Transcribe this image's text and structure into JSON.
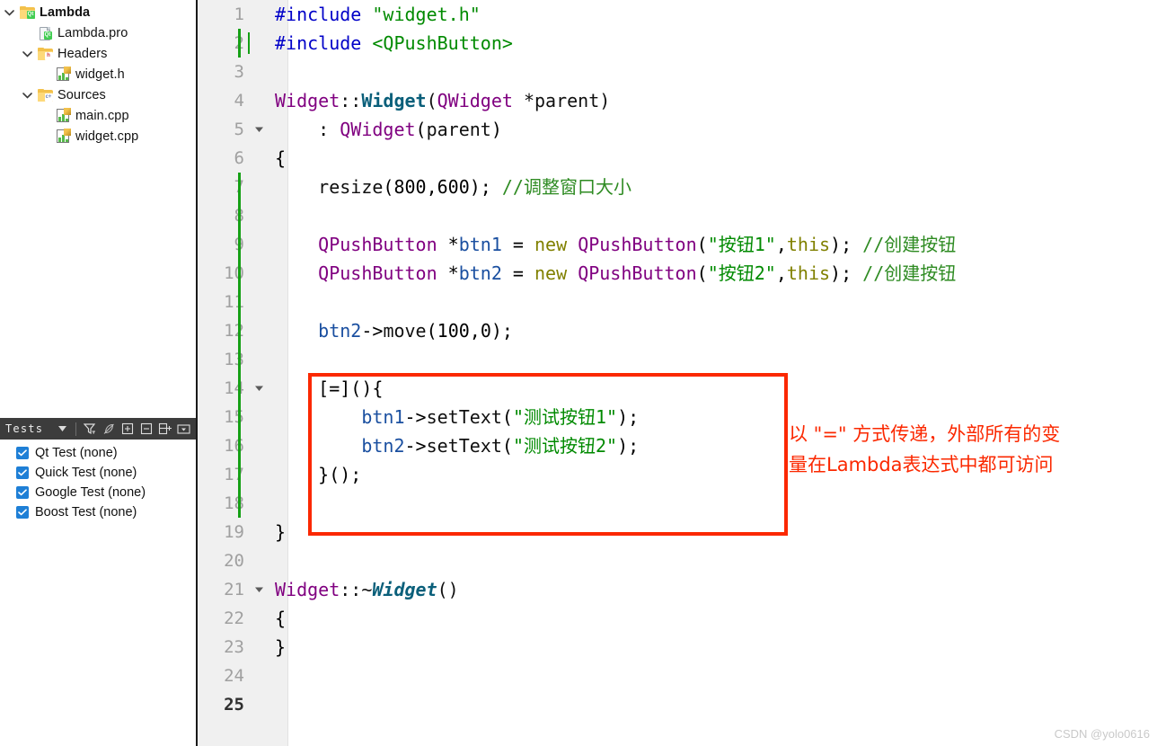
{
  "sidebar": {
    "tree": [
      {
        "label": "Lambda",
        "indent": 0,
        "chevron": "down",
        "icon": "folder-qt-icon",
        "bold": true
      },
      {
        "label": "Lambda.pro",
        "indent": 1,
        "chevron": "none",
        "icon": "file-qt-icon",
        "bold": false
      },
      {
        "label": "Headers",
        "indent": 1,
        "chevron": "down",
        "icon": "folder-h-icon",
        "bold": false
      },
      {
        "label": "widget.h",
        "indent": 2,
        "chevron": "none",
        "icon": "source-file-icon",
        "bold": false
      },
      {
        "label": "Sources",
        "indent": 1,
        "chevron": "down",
        "icon": "folder-cpp-icon",
        "bold": false
      },
      {
        "label": "main.cpp",
        "indent": 2,
        "chevron": "none",
        "icon": "source-file-icon",
        "bold": false
      },
      {
        "label": "widget.cpp",
        "indent": 2,
        "chevron": "none",
        "icon": "source-file-icon",
        "bold": false
      }
    ],
    "tests_toolbar": {
      "title": "Tests",
      "buttons": [
        {
          "name": "tests-pane-dropdown",
          "icon": "chevron-down-icon"
        },
        {
          "name": "tests-filter",
          "icon": "filter-icon"
        },
        {
          "name": "tests-run-disabled",
          "icon": "leaf-icon"
        },
        {
          "name": "tests-expand-all",
          "icon": "plus-box-icon"
        },
        {
          "name": "tests-collapse-all",
          "icon": "minus-box-icon"
        },
        {
          "name": "tests-expand-one",
          "icon": "expand-node-icon"
        },
        {
          "name": "tests-options",
          "icon": "dropdown-box-icon"
        }
      ]
    },
    "tests": [
      {
        "label": "Qt Test (none)",
        "checked": true
      },
      {
        "label": "Quick Test (none)",
        "checked": true
      },
      {
        "label": "Google Test (none)",
        "checked": true
      },
      {
        "label": "Boost Test (none)",
        "checked": true
      }
    ]
  },
  "editor": {
    "current_line": 25,
    "cursor_line": 2,
    "lines": [
      {
        "n": 1,
        "fold": false,
        "changed": false
      },
      {
        "n": 2,
        "fold": false,
        "changed": true
      },
      {
        "n": 3,
        "fold": false,
        "changed": false
      },
      {
        "n": 4,
        "fold": false,
        "changed": false
      },
      {
        "n": 5,
        "fold": true,
        "changed": false
      },
      {
        "n": 6,
        "fold": false,
        "changed": false
      },
      {
        "n": 7,
        "fold": false,
        "changed": true
      },
      {
        "n": 8,
        "fold": false,
        "changed": true
      },
      {
        "n": 9,
        "fold": false,
        "changed": true
      },
      {
        "n": 10,
        "fold": false,
        "changed": true
      },
      {
        "n": 11,
        "fold": false,
        "changed": true
      },
      {
        "n": 12,
        "fold": false,
        "changed": true
      },
      {
        "n": 13,
        "fold": false,
        "changed": true
      },
      {
        "n": 14,
        "fold": true,
        "changed": true
      },
      {
        "n": 15,
        "fold": false,
        "changed": true
      },
      {
        "n": 16,
        "fold": false,
        "changed": true
      },
      {
        "n": 17,
        "fold": false,
        "changed": true
      },
      {
        "n": 18,
        "fold": false,
        "changed": true
      },
      {
        "n": 19,
        "fold": false,
        "changed": false
      },
      {
        "n": 20,
        "fold": false,
        "changed": false
      },
      {
        "n": 21,
        "fold": true,
        "changed": false
      },
      {
        "n": 22,
        "fold": false,
        "changed": false
      },
      {
        "n": 23,
        "fold": false,
        "changed": false
      },
      {
        "n": 24,
        "fold": false,
        "changed": false
      },
      {
        "n": 25,
        "fold": false,
        "changed": false
      }
    ],
    "code_text": [
      "#include \"widget.h\"",
      "#include <QPushButton>",
      "",
      "Widget::Widget(QWidget *parent)",
      "    : QWidget(parent)",
      "{",
      "    resize(800,600); //调整窗口大小",
      "",
      "    QPushButton *btn1 = new QPushButton(\"按钮1\",this); //创建按钮",
      "    QPushButton *btn2 = new QPushButton(\"按钮2\",this); //创建按钮",
      "",
      "    btn2->move(100,0);",
      "",
      "    [=](){",
      "        btn1->setText(\"测试按钮1\");",
      "        btn2->setText(\"测试按钮2\");",
      "    }();",
      "",
      "}",
      "",
      "Widget::~Widget()",
      "{",
      "}",
      "",
      ""
    ]
  },
  "annotation": {
    "line1": "以 \"=\" 方式传递，外部所有的变",
    "line2": "量在Lambda表达式中都可访问",
    "color": "#fb2800"
  },
  "watermark": "CSDN @yolo0616",
  "colors": {
    "preprocessor": "#0000c8",
    "string": "#008a00",
    "type": "#800080",
    "keyword": "#808000",
    "comment": "#2e8b22",
    "function": "#0a5f7a",
    "variable": "#1a4fa0",
    "changebar": "#15a015",
    "toolbar_bg": "#3c3c3c",
    "checkbox": "#1e7fd6"
  }
}
